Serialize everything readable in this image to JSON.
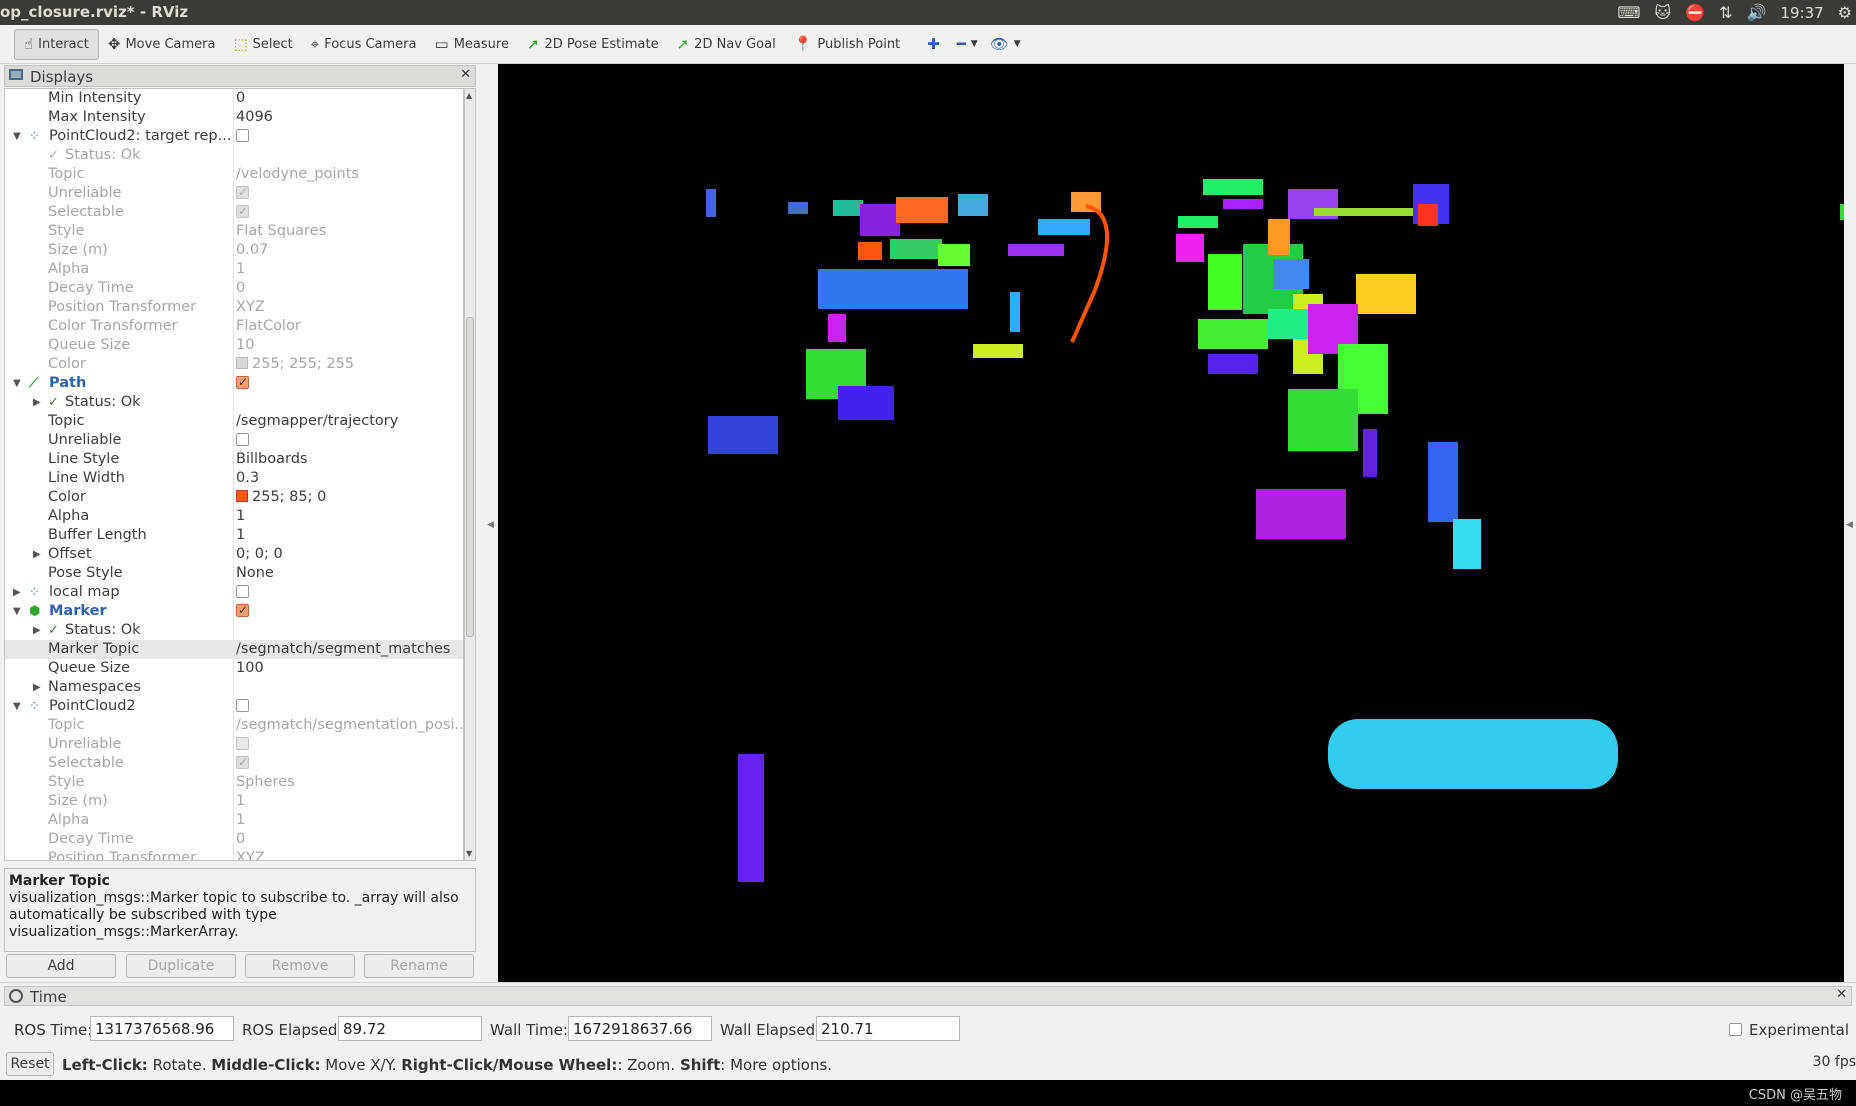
{
  "window": {
    "title": "op_closure.rviz* - RViz"
  },
  "tray": {
    "icons": [
      "keyboard-icon",
      "cat-icon",
      "stop-icon",
      "network-icon",
      "volume-icon",
      "gear-icon"
    ],
    "clock": "19:37"
  },
  "toolbar": {
    "tools": [
      {
        "label": "Interact",
        "icon": "hand-icon",
        "active": true
      },
      {
        "label": "Move Camera",
        "icon": "move-camera-icon",
        "active": false
      },
      {
        "label": "Select",
        "icon": "select-icon",
        "active": false
      },
      {
        "label": "Focus Camera",
        "icon": "focus-camera-icon",
        "active": false
      },
      {
        "label": "Measure",
        "icon": "ruler-icon",
        "active": false
      },
      {
        "label": "2D Pose Estimate",
        "icon": "green-arrow-icon",
        "active": false
      },
      {
        "label": "2D Nav Goal",
        "icon": "green-arrow-icon",
        "active": false
      },
      {
        "label": "Publish Point",
        "icon": "map-pin-icon",
        "active": false
      }
    ]
  },
  "displays": {
    "title": "Displays",
    "rows": [
      {
        "key": "Min Intensity",
        "value": "0"
      },
      {
        "key": "Max Intensity",
        "value": "4096"
      },
      {
        "key": "PointCloud2: target rep...",
        "value": ""
      },
      {
        "key": "Status: Ok",
        "value": ""
      },
      {
        "key": "Topic",
        "value": "/velodyne_points"
      },
      {
        "key": "Unreliable",
        "value": ""
      },
      {
        "key": "Selectable",
        "value": ""
      },
      {
        "key": "Style",
        "value": "Flat Squares"
      },
      {
        "key": "Size (m)",
        "value": "0.07"
      },
      {
        "key": "Alpha",
        "value": "1"
      },
      {
        "key": "Decay Time",
        "value": "0"
      },
      {
        "key": "Position Transformer",
        "value": "XYZ"
      },
      {
        "key": "Color Transformer",
        "value": "FlatColor"
      },
      {
        "key": "Queue Size",
        "value": "10"
      },
      {
        "key": "Color",
        "value": "255; 255; 255"
      },
      {
        "key": "Path",
        "value": ""
      },
      {
        "key": "Status: Ok",
        "value": ""
      },
      {
        "key": "Topic",
        "value": "/segmapper/trajectory"
      },
      {
        "key": "Unreliable",
        "value": ""
      },
      {
        "key": "Line Style",
        "value": "Billboards"
      },
      {
        "key": "Line Width",
        "value": "0.3"
      },
      {
        "key": "Color",
        "value": "255; 85; 0"
      },
      {
        "key": "Alpha",
        "value": "1"
      },
      {
        "key": "Buffer Length",
        "value": "1"
      },
      {
        "key": "Offset",
        "value": "0; 0; 0"
      },
      {
        "key": "Pose Style",
        "value": "None"
      },
      {
        "key": "local map",
        "value": ""
      },
      {
        "key": "Marker",
        "value": ""
      },
      {
        "key": "Status: Ok",
        "value": ""
      },
      {
        "key": "Marker Topic",
        "value": "/segmatch/segment_matches"
      },
      {
        "key": "Queue Size",
        "value": "100"
      },
      {
        "key": "Namespaces",
        "value": ""
      },
      {
        "key": "PointCloud2",
        "value": ""
      },
      {
        "key": "Topic",
        "value": "/segmatch/segmentation_posi..."
      },
      {
        "key": "Unreliable",
        "value": ""
      },
      {
        "key": "Selectable",
        "value": ""
      },
      {
        "key": "Style",
        "value": "Spheres"
      },
      {
        "key": "Size (m)",
        "value": "1"
      },
      {
        "key": "Alpha",
        "value": "1"
      },
      {
        "key": "Decay Time",
        "value": "0"
      },
      {
        "key": "Position Transformer",
        "value": "XYZ"
      }
    ],
    "help_title": "Marker Topic",
    "help_text": "visualization_msgs::Marker topic to subscribe to. _array will also automatically be subscribed with type visualization_msgs::MarkerArray.",
    "buttons": {
      "add": "Add",
      "duplicate": "Duplicate",
      "remove": "Remove",
      "rename": "Rename"
    }
  },
  "colors": {
    "path": "#ff5500",
    "white": "#ffffff"
  },
  "time": {
    "title": "Time",
    "ros_time_label": "ROS Time:",
    "ros_time": "1317376568.96",
    "ros_elapsed_label": "ROS Elapsed:",
    "ros_elapsed": "89.72",
    "wall_time_label": "Wall Time:",
    "wall_time": "1672918637.66",
    "wall_elapsed_label": "Wall Elapsed:",
    "wall_elapsed": "210.71",
    "experimental_label": "Experimental"
  },
  "status": {
    "reset": "Reset",
    "hint_b1": "Left-Click:",
    "hint_t1": " Rotate. ",
    "hint_b2": "Middle-Click:",
    "hint_t2": " Move X/Y. ",
    "hint_b3": "Right-Click/Mouse Wheel:",
    "hint_t3": ": Zoom. ",
    "hint_b4": "Shift",
    "hint_t4": ": More options.",
    "fps": "30 fps"
  },
  "watermark": "CSDN @吴五物"
}
